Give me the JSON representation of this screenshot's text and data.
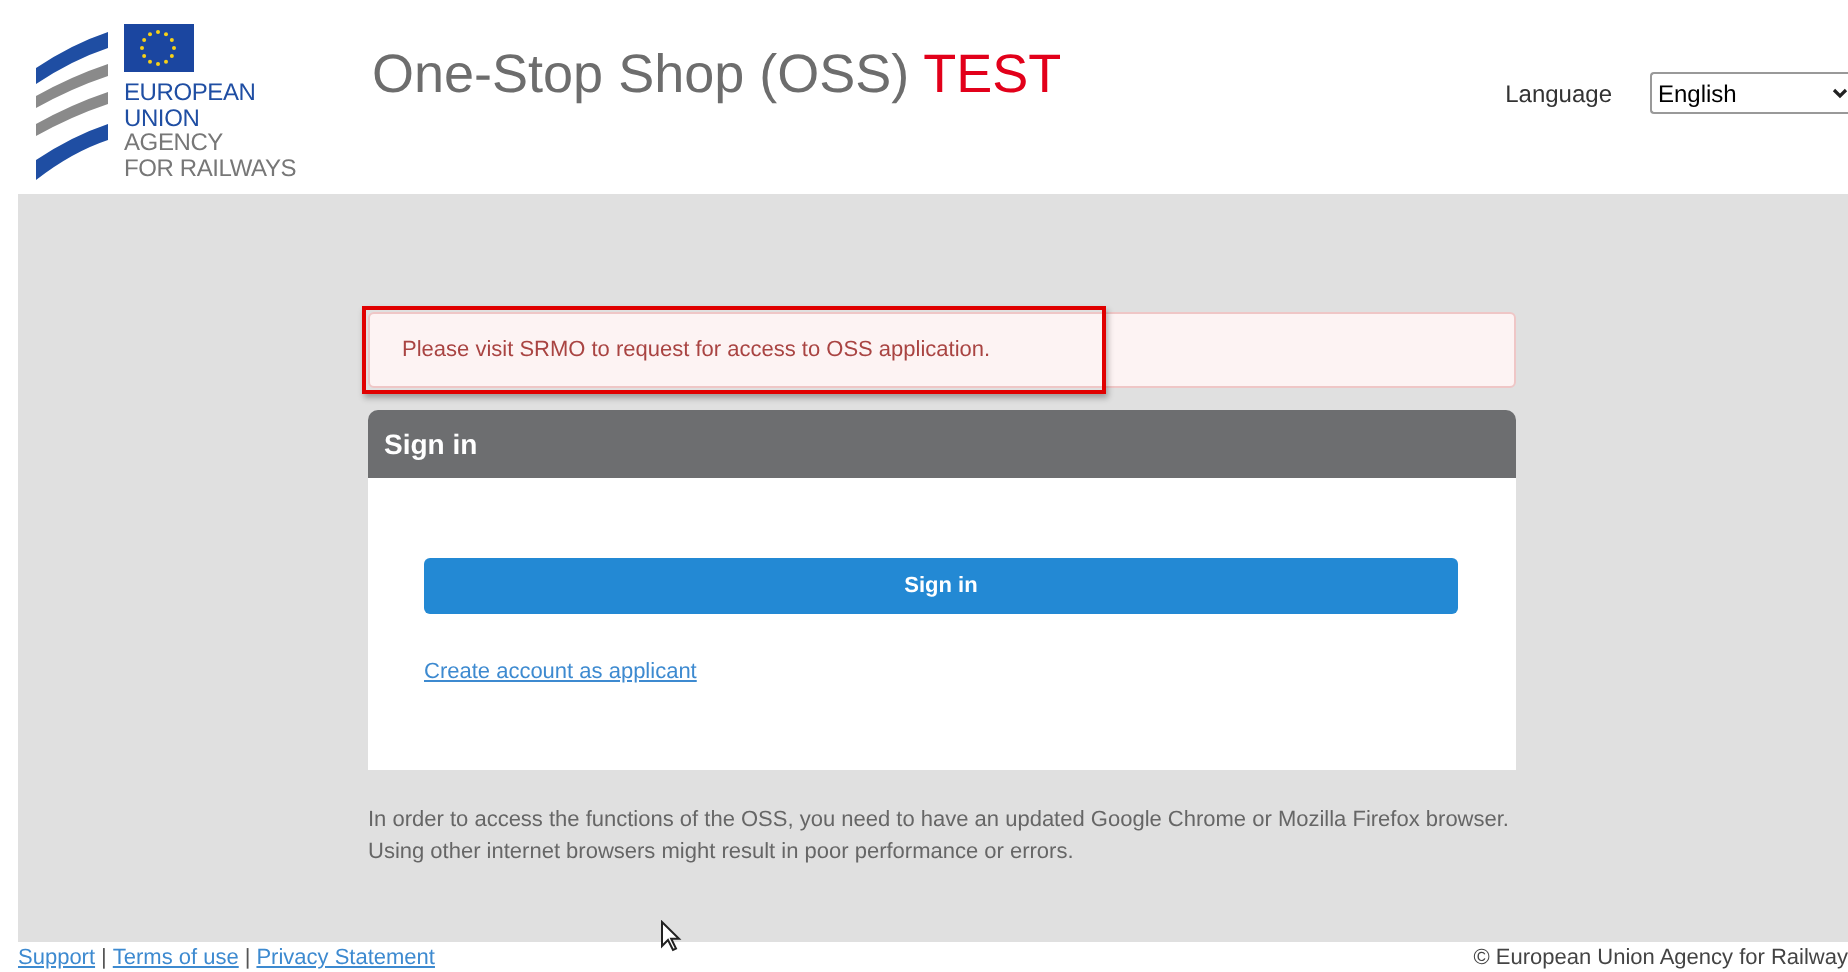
{
  "logo": {
    "lines": [
      {
        "text": "EUROPEAN",
        "kind": "primary"
      },
      {
        "text": "UNION",
        "kind": "primary"
      },
      {
        "text": "AGENCY",
        "kind": "secondary"
      },
      {
        "text": "FOR RAILWAYS",
        "kind": "secondary"
      }
    ]
  },
  "header": {
    "title": "One-Stop Shop (OSS)",
    "badge": "TEST",
    "language_label": "Language",
    "language_value": "English"
  },
  "alert": {
    "text": "Please visit SRMO to request for access to OSS application.",
    "highlighted": true
  },
  "signin": {
    "title": "Sign in",
    "button": "Sign in",
    "link": "Create account as applicant"
  },
  "notice": [
    "In order to access the functions of the OSS, you need to have an updated Google Chrome or Mozilla Firefox browser.",
    "Using other internet browsers might result in poor performance or errors."
  ],
  "footer": {
    "links": [
      "Support",
      "Terms of use",
      "Privacy Statement"
    ],
    "separator": "|",
    "copyright": "© European Union Agency for Railway"
  }
}
